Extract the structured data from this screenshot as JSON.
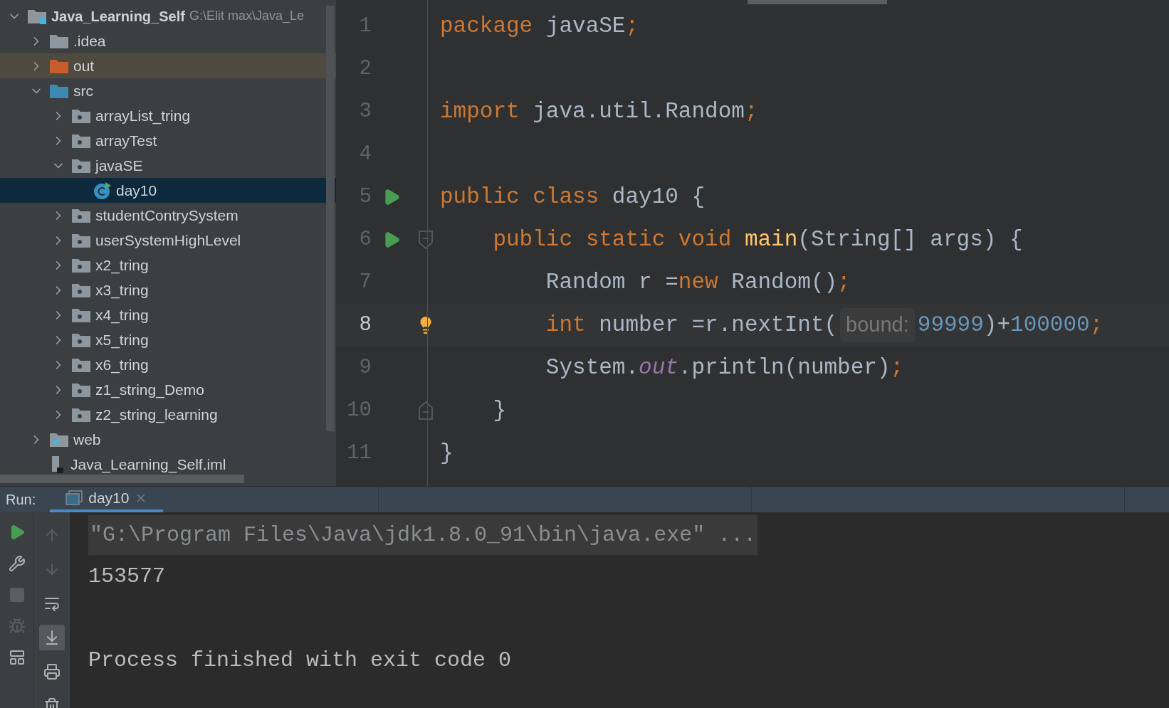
{
  "project_tree": {
    "items": [
      {
        "kind": "project",
        "label": "Java_Learning_Self",
        "path": "G:\\Elit max\\Java_Le",
        "expanded": true,
        "selected": false,
        "children": [
          {
            "kind": "folder",
            "label": ".idea",
            "expanded": false,
            "selected": false
          },
          {
            "kind": "excluded",
            "label": "out",
            "expanded": false,
            "selected": false
          },
          {
            "kind": "source",
            "label": "src",
            "expanded": true,
            "selected": false,
            "children": [
              {
                "kind": "package",
                "label": "arrayList_tring",
                "expanded": false,
                "selected": false
              },
              {
                "kind": "package",
                "label": "arrayTest",
                "expanded": false,
                "selected": false
              },
              {
                "kind": "package",
                "label": "javaSE",
                "expanded": true,
                "selected": false,
                "children": [
                  {
                    "kind": "class",
                    "label": "day10",
                    "selected": true
                  }
                ]
              },
              {
                "kind": "package",
                "label": "studentContrySystem",
                "expanded": false,
                "selected": false
              },
              {
                "kind": "package",
                "label": "userSystemHighLevel",
                "expanded": false,
                "selected": false
              },
              {
                "kind": "package",
                "label": "x2_tring",
                "expanded": false,
                "selected": false
              },
              {
                "kind": "package",
                "label": "x3_tring",
                "expanded": false,
                "selected": false
              },
              {
                "kind": "package",
                "label": "x4_tring",
                "expanded": false,
                "selected": false
              },
              {
                "kind": "package",
                "label": "x5_tring",
                "expanded": false,
                "selected": false
              },
              {
                "kind": "package",
                "label": "x6_tring",
                "expanded": false,
                "selected": false
              },
              {
                "kind": "package",
                "label": "z1_string_Demo",
                "expanded": false,
                "selected": false
              },
              {
                "kind": "package",
                "label": "z2_string_learning",
                "expanded": false,
                "selected": false
              }
            ]
          },
          {
            "kind": "web",
            "label": "web",
            "expanded": false,
            "selected": false
          },
          {
            "kind": "module",
            "label": "Java_Learning_Self.iml",
            "selected": false
          }
        ]
      }
    ]
  },
  "editor": {
    "lines": [
      {
        "number": "1",
        "run": false,
        "current": false,
        "bulb": false,
        "fold_start": false,
        "fold_end": false,
        "tokens": [
          {
            "kind": "keyword",
            "text": "package "
          },
          {
            "kind": "plain",
            "text": "javaSE"
          },
          {
            "kind": "semi",
            "text": ";"
          }
        ]
      },
      {
        "number": "2",
        "run": false,
        "current": false,
        "bulb": false,
        "fold_start": false,
        "fold_end": false
      },
      {
        "number": "3",
        "run": false,
        "current": false,
        "bulb": false,
        "fold_start": false,
        "fold_end": false,
        "tokens": [
          {
            "kind": "keyword",
            "text": "import "
          },
          {
            "kind": "plain",
            "text": "java.util.Random"
          },
          {
            "kind": "semi",
            "text": ";"
          }
        ]
      },
      {
        "number": "4",
        "run": false,
        "current": false,
        "bulb": false,
        "fold_start": false,
        "fold_end": false
      },
      {
        "number": "5",
        "run": true,
        "current": false,
        "bulb": false,
        "fold_start": false,
        "fold_end": false,
        "tokens": [
          {
            "kind": "keyword",
            "text": "public class "
          },
          {
            "kind": "plain",
            "text": "day10 {"
          }
        ]
      },
      {
        "number": "6",
        "run": true,
        "current": false,
        "bulb": false,
        "fold_start": true,
        "fold_end": false,
        "tokens": [
          {
            "kind": "keyword",
            "text": "    public static void "
          },
          {
            "kind": "method",
            "text": "main"
          },
          {
            "kind": "plain",
            "text": "(String[] args) {"
          }
        ]
      },
      {
        "number": "7",
        "run": false,
        "current": false,
        "bulb": false,
        "fold_start": false,
        "fold_end": false,
        "tokens": [
          {
            "kind": "plain",
            "text": "        Random r ="
          },
          {
            "kind": "keyword",
            "text": "new "
          },
          {
            "kind": "plain",
            "text": "Random()"
          },
          {
            "kind": "semi",
            "text": ";"
          }
        ]
      },
      {
        "number": "8",
        "run": false,
        "current": true,
        "bulb": true,
        "fold_start": false,
        "fold_end": false,
        "tokens": [
          {
            "kind": "keyword",
            "text": "        int "
          },
          {
            "kind": "plain",
            "text": "number =r.nextInt("
          },
          {
            "kind": "hint",
            "text": "bound:"
          },
          {
            "kind": "number",
            "text": "99999"
          },
          {
            "kind": "plain",
            "text": ")+"
          },
          {
            "kind": "number",
            "text": "100000"
          },
          {
            "kind": "semi",
            "text": ";"
          }
        ]
      },
      {
        "number": "9",
        "run": false,
        "current": false,
        "bulb": false,
        "fold_start": false,
        "fold_end": false,
        "tokens": [
          {
            "kind": "plain",
            "text": "        System."
          },
          {
            "kind": "static",
            "text": "out"
          },
          {
            "kind": "plain",
            "text": ".println(number)"
          },
          {
            "kind": "semi",
            "text": ";"
          }
        ]
      },
      {
        "number": "10",
        "run": false,
        "current": false,
        "bulb": false,
        "fold_start": false,
        "fold_end": true,
        "tokens": [
          {
            "kind": "plain",
            "text": "    }"
          }
        ]
      },
      {
        "number": "11",
        "run": false,
        "current": false,
        "bulb": false,
        "fold_start": false,
        "fold_end": false,
        "tokens": [
          {
            "kind": "plain",
            "text": "}"
          }
        ]
      }
    ]
  },
  "run_panel": {
    "label": "Run:",
    "tabs": [
      {
        "label": "day10",
        "selected": true
      }
    ],
    "toolbar_left": [
      {
        "kind": "rerun",
        "disabled": false
      },
      {
        "kind": "settings",
        "disabled": false
      },
      {
        "kind": "stop",
        "disabled": true
      },
      {
        "kind": "debug",
        "disabled": true
      },
      {
        "kind": "layout",
        "disabled": false
      }
    ],
    "toolbar_right": [
      {
        "kind": "up",
        "disabled": true,
        "on": false
      },
      {
        "kind": "down",
        "disabled": true,
        "on": false
      },
      {
        "kind": "wrap",
        "disabled": false,
        "on": false
      },
      {
        "kind": "scroll-end",
        "disabled": false,
        "on": true
      },
      {
        "kind": "print",
        "disabled": false,
        "on": false
      },
      {
        "kind": "trash",
        "disabled": false,
        "on": false
      }
    ],
    "console": [
      {
        "kind": "command",
        "text": "\"G:\\Program Files\\Java\\jdk1.8.0_91\\bin\\java.exe\" ..."
      },
      {
        "kind": "output",
        "text": "153577"
      },
      {
        "kind": "exit",
        "text": "Process finished with exit code 0"
      }
    ]
  }
}
